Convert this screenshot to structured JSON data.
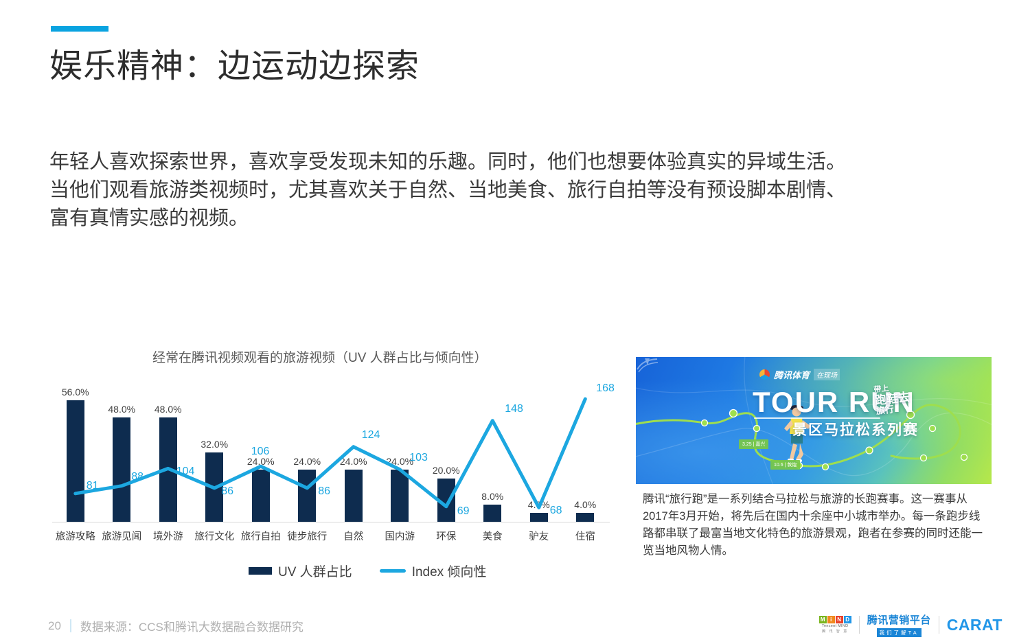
{
  "slide": {
    "title": "娱乐精神：边运动边探索",
    "accent_color": "#0aa3e0",
    "body": [
      "年轻人喜欢探索世界，喜欢享受发现未知的乐趣。同时，他们也想要体验真实的异域生活。",
      "当他们观看旅游类视频时，尤其喜欢关于自然、当地美食、旅行自拍等没有预设脚本剧情、",
      "富有真情实感的视频。"
    ]
  },
  "chart_data": {
    "type": "bar",
    "title": "经常在腾讯视频观看的旅游视频（UV 人群占比与倾向性）",
    "categories": [
      "旅游攻略",
      "旅游见闻",
      "境外游",
      "旅行文化",
      "旅行自拍",
      "徒步旅行",
      "自然",
      "国内游",
      "环保",
      "美食",
      "驴友",
      "住宿"
    ],
    "series": [
      {
        "name": "UV 人群占比",
        "kind": "bar",
        "color": "#0e2c4f",
        "values": [
          56.0,
          48.0,
          48.0,
          32.0,
          24.0,
          24.0,
          24.0,
          24.0,
          20.0,
          8.0,
          4.0,
          4.0
        ],
        "labels": [
          "56.0%",
          "48.0%",
          "48.0%",
          "32.0%",
          "24.0%",
          "24.0%",
          "24.0%",
          "24.0%",
          "20.0%",
          "8.0%",
          "4.0%",
          "4.0%"
        ]
      },
      {
        "name": "Index 倾向性",
        "kind": "line",
        "color": "#1ca7e0",
        "values": [
          81,
          88,
          104,
          86,
          106,
          86,
          124,
          103,
          69,
          148,
          68,
          168
        ],
        "labels": [
          "81",
          "88",
          "104",
          "86",
          "106",
          "86",
          "124",
          "103",
          "69",
          "148",
          "68",
          "168"
        ]
      }
    ],
    "xlabel": "",
    "ylabel": "",
    "ylim_bar": [
      0,
      60
    ],
    "ylim_line": [
      60,
      175
    ],
    "grid": false,
    "legend_position": "bottom"
  },
  "promo": {
    "banner": {
      "brand": "腾讯体育",
      "brand_tag": "在现场",
      "headline": "TOUR RUN",
      "subline": "景区马拉松系列赛",
      "stamp_line1": "带上",
      "stamp_line2": "跑鞋去",
      "stamp_line3": "旅行",
      "pin_1": "3.25 | 嘉兴",
      "pin_2": "10.6 | 敦煌"
    },
    "caption": "腾讯“旅行跑”是一系列结合马拉松与旅游的长跑赛事。这一赛事从2017年3月开始，将先后在国内十余座中小城市举办。每一条跑步线路都串联了最富当地文化特色的旅游景观，跑者在参赛的同时还能一览当地风物人情。"
  },
  "footer": {
    "page_number": "20",
    "source": "数据来源：CCS和腾讯大数据融合数据研究",
    "mind_letters": [
      "M",
      "i",
      "N",
      "D"
    ],
    "mind_colors": [
      "#7ab51d",
      "#f18a1e",
      "#e8402a",
      "#2196e8"
    ],
    "mind_caption": "Tencent MIND",
    "mind_caption_cn": "腾 讯 智 慧",
    "tencent_main": "腾讯营销平台",
    "tencent_sub": "我们了解TA",
    "carat": "CARAT"
  }
}
